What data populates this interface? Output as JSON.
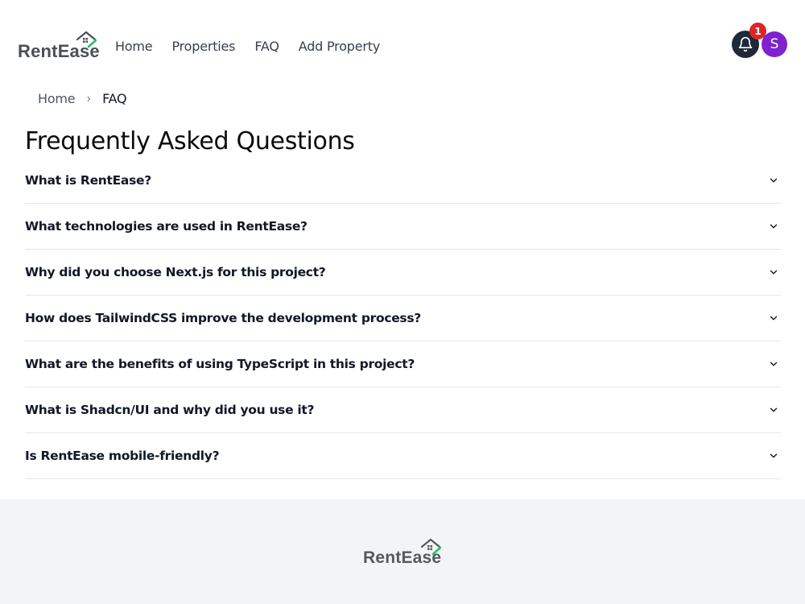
{
  "brand": {
    "name": "RentEase"
  },
  "nav": [
    {
      "label": "Home"
    },
    {
      "label": "Properties"
    },
    {
      "label": "FAQ"
    },
    {
      "label": "Add Property"
    }
  ],
  "notifications": {
    "count": "1"
  },
  "user": {
    "initial": "S"
  },
  "breadcrumb": {
    "home": "Home",
    "separator": "›",
    "current": "FAQ"
  },
  "page": {
    "title": "Frequently Asked Questions"
  },
  "faqs": [
    {
      "question": "What is RentEase?"
    },
    {
      "question": "What technologies are used in RentEase?"
    },
    {
      "question": "Why did you choose Next.js for this project?"
    },
    {
      "question": "How does TailwindCSS improve the development process?"
    },
    {
      "question": "What are the benefits of using TypeScript in this project?"
    },
    {
      "question": "What is Shadcn/UI and why did you use it?"
    },
    {
      "question": "Is RentEase mobile-friendly?"
    }
  ],
  "footer": {
    "brand": "RentEase"
  },
  "colors": {
    "accent_green": "#22c55e",
    "avatar": "#7e22ce",
    "badge": "#dc2626",
    "bell_bg": "#1f2937"
  },
  "icons": [
    "house-logo-icon",
    "bell-icon",
    "chevron-down-icon"
  ]
}
